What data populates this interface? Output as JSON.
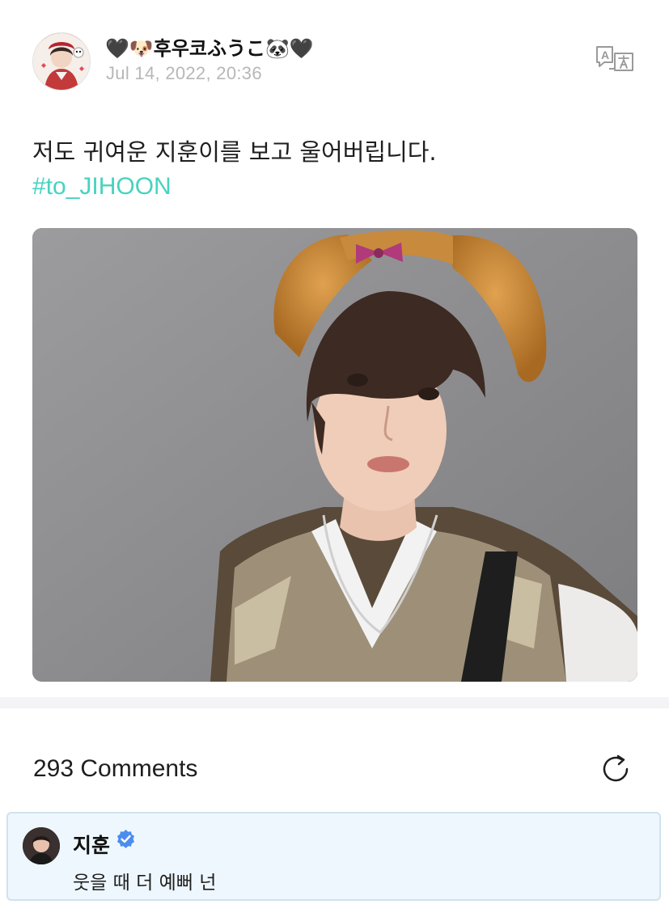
{
  "post": {
    "author_name": "🖤🐶후우코ふうこ🐼🖤",
    "date": "Jul 14, 2022, 20:36",
    "text": "저도 귀여운 지훈이를 보고 울어버립니다.",
    "hashtag": "#to_JIHOON",
    "translate_icon": "translate-icon",
    "photo_icon": "photo-image"
  },
  "comments": {
    "count_label": "293 Comments",
    "refresh_icon": "refresh-icon",
    "items": [
      {
        "author": "지훈",
        "verified_icon": "verified-badge-icon",
        "text": "웃을 때 더 예뻐 넌"
      }
    ]
  },
  "colors": {
    "hashtag": "#47d3bf",
    "date": "#b7b7b7",
    "verified": "#4b8cf0",
    "comment_bg": "#eef7fd",
    "comment_border": "#cfe2ee"
  }
}
